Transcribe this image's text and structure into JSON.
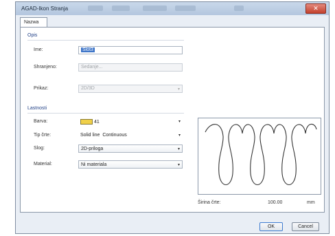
{
  "window": {
    "title": "AGAD-Ikon Stranja"
  },
  "tabs": [
    {
      "label": "Nazwa"
    }
  ],
  "groups": {
    "opis": "Opis",
    "lastnosti": "Lastnosti"
  },
  "fields": {
    "ime": {
      "label": "Ime:",
      "value": "Slot3"
    },
    "shranjeno": {
      "label": "Shranjeno:",
      "value": "Sedanje..."
    },
    "prikaz": {
      "label": "Prikaz:",
      "value": "2D/3D"
    },
    "barva": {
      "label": "Barva:",
      "value": "41"
    },
    "tip_crte": {
      "label": "Tip črte:",
      "value": "Solid line",
      "secondary": "Continuous"
    },
    "slog": {
      "label": "Slog:",
      "value": "2D-priloga"
    },
    "material": {
      "label": "Material:",
      "value": "Ni materiala"
    }
  },
  "preview": {
    "scale_label": "Širina črte:",
    "scale_value": "100.00",
    "unit": "mm"
  },
  "buttons": {
    "ok": "OK",
    "cancel": "Cancel"
  },
  "colors": {
    "selection": "#3b73c7",
    "swatch": "#f0d049",
    "title_gradient": "#c9d8ea"
  }
}
